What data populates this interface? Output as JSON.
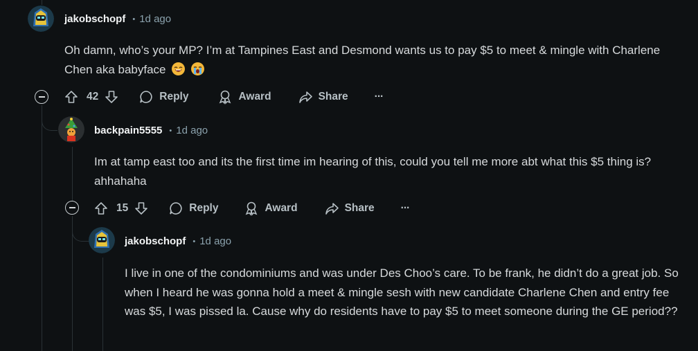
{
  "comments": [
    {
      "author": "jakobschopf",
      "age": "1d ago",
      "body": "Oh damn, who’s your MP? I’m at Tampines East and Desmond wants us to pay $5 to meet & mingle with Charlene Chen aka babyface",
      "votes": "42",
      "reply_label": "Reply",
      "award_label": "Award",
      "share_label": "Share",
      "more_label": "···"
    },
    {
      "author": "backpain5555",
      "age": "1d ago",
      "body": "Im at tamp east too and its the first time im hearing of this, could you tell me more abt what this $5 thing is? ahhahaha",
      "votes": "15",
      "reply_label": "Reply",
      "award_label": "Award",
      "share_label": "Share",
      "more_label": "···"
    },
    {
      "author": "jakobschopf",
      "age": "1d ago",
      "body": "I live in one of the condominiums and was under Des Choo’s care. To be frank, he didn’t do a great job. So when I heard he was gonna hold a meet & mingle sesh with new candidate Charlene Chen and entry fee was $5, I was pissed la. Cause why do residents have to pay $5 to meet someone during the GE period??"
    }
  ],
  "separator": "•",
  "colors": {
    "background": "#0e1113",
    "text": "#d7dadc",
    "muted": "#8ba2ad",
    "thread": "#2a3236"
  }
}
